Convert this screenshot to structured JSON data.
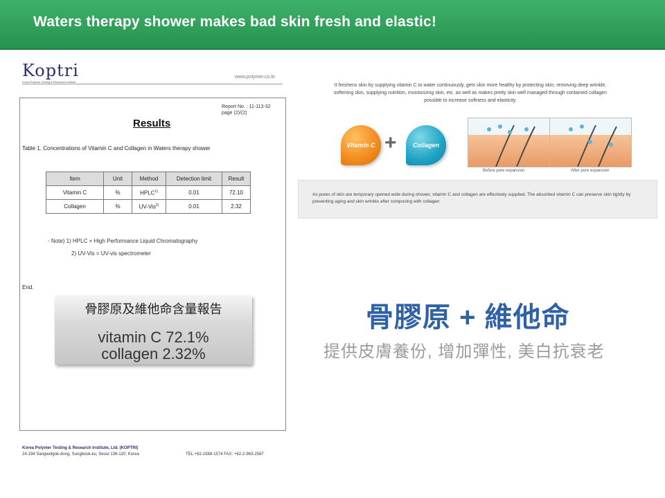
{
  "banner": {
    "title": "Waters therapy shower makes bad skin fresh and elastic!"
  },
  "report": {
    "logo": "Koptri",
    "logo_sub": "Korea Polymer Testing & Research Institute",
    "website": "www.polymer.co.kr",
    "report_no": "Report No. : 11-113-32",
    "page": "page (2)/(2)",
    "heading": "Results",
    "table_caption": "Table 1. Concentrations of Vitamin C and Collagen in Waters therapy shower",
    "table": {
      "headers": [
        "Item",
        "Unit",
        "Method",
        "Detection limit",
        "Result"
      ],
      "rows": [
        {
          "item": "Vitamin C",
          "unit": "%",
          "method": "HPLC",
          "method_sup": "1)",
          "detection_limit": "0.01",
          "result": "72.10"
        },
        {
          "item": "Collagen",
          "unit": "%",
          "method": "UV-Vis",
          "method_sup": "2)",
          "detection_limit": "0.01",
          "result": "2.32"
        }
      ]
    },
    "note1": "- Note) 1) HPLC = High Performance Liquid Chromatography",
    "note2": "2) UV-Vis = UV-vis spectrometer",
    "end": "End.",
    "summary": {
      "title": "骨膠原及維他命含量報告",
      "line1": "vitamin C 72.1%",
      "line2": "collagen 2.32%"
    },
    "footer": {
      "name": "Korea Polymer Testing & Research Institute, Ltd. (KOPTRI)",
      "address": "24-194 Sangwolgok-dong, Sungbook-ku, Seoul 136-120, Korea",
      "tel": "TEL:+82-1588-1574 FAX: +82-2-963-2587"
    }
  },
  "info": {
    "intro": "It freshens skin by supplying vitamin C to water continuously, gets skin more healthy by protecting skin, removing deep wrinkle, softening skin, supplying nutrition, moisturizing skin, etc. as well as makes pretty skin well managed through contained collagen possible to increase softness and elasticity.",
    "badge_vitamin": "Vitamin C",
    "badge_collagen": "Collagen",
    "plus": "+",
    "caption_before": "Before pore expansion",
    "caption_after": "After pore expansion",
    "description": "As pores of skin are temporary opened wide during shower, vitamin C and collagen are effectively supplied. The absorbed vitamin C can preserve skin tightly by preventing aging and skin wrinkle after composing with collagen",
    "cn_title": "骨膠原 + 維他命",
    "cn_subtitle": "提供皮膚養份, 增加彈性, 美白抗衰老"
  },
  "colors": {
    "banner_green": "#2a9a55",
    "vitamin_orange": "#f28a1e",
    "collagen_teal": "#1ea3c4",
    "title_blue": "#2e61a6"
  }
}
